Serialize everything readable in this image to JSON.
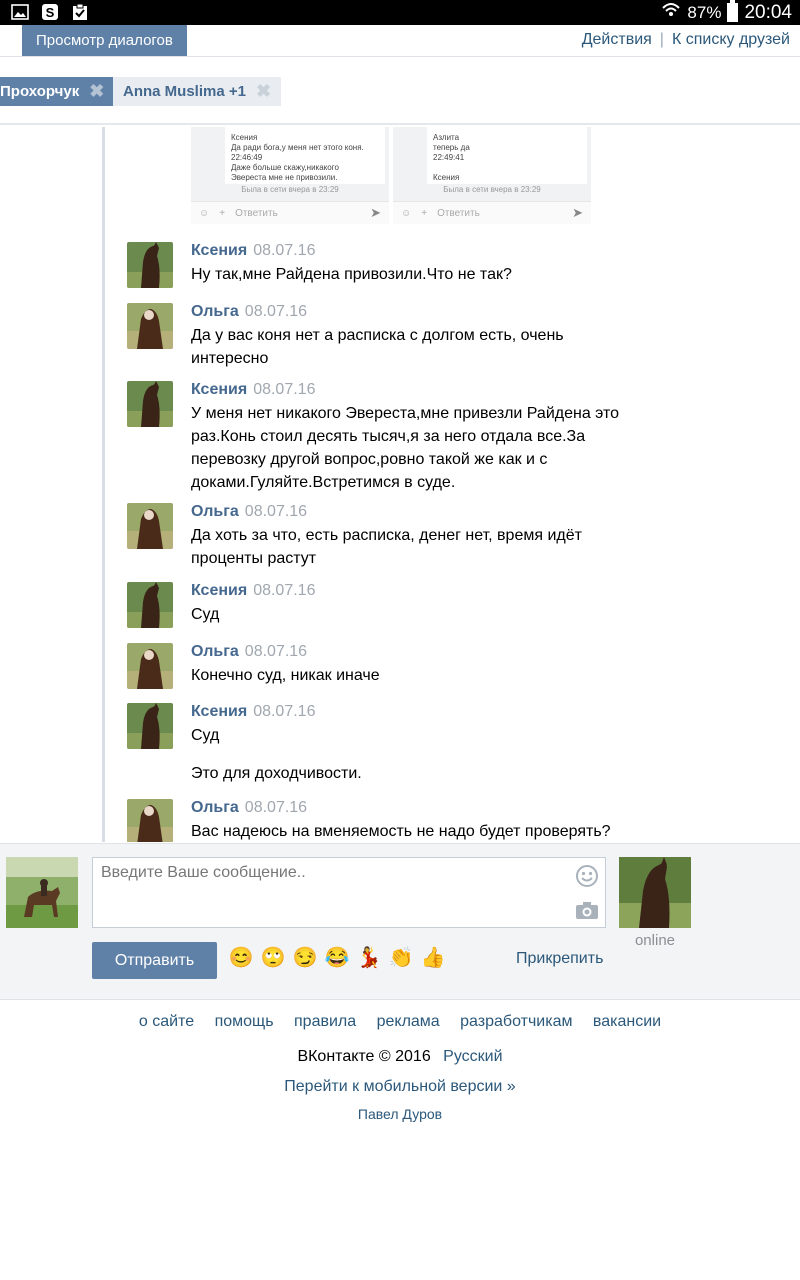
{
  "status_bar": {
    "battery": "87%",
    "time": "20:04"
  },
  "nav": {
    "active_tab": "Просмотр диалогов",
    "actions": "Действия",
    "separator": "|",
    "friends_link": "К списку друзей"
  },
  "dialog_tabs": [
    {
      "label": "Прохорчук"
    },
    {
      "label": "Anna Muslima +1"
    }
  ],
  "screenshot_thumbs": [
    {
      "author": "Ксения",
      "lines": [
        "Да ради бога,у меня нет этого коня.",
        "22:46:49",
        "Даже больше скажу,никакого",
        "Эвереста мне не привозили."
      ],
      "seen": "Была в сети вчера в 23:29",
      "reply": "Ответить"
    },
    {
      "author": "Азлита",
      "lines": [
        "теперь да",
        "22:49:41",
        "",
        "Ксения"
      ],
      "seen": "Была в сети вчера в 23:29",
      "reply": "Ответить"
    }
  ],
  "messages": [
    {
      "author": "Ксения",
      "date": "08.07.16",
      "text": "Ну так,мне Райдена привозили.Что не так?"
    },
    {
      "author": "Ольга",
      "date": "08.07.16",
      "text": "Да у вас коня нет а расписка с долгом есть, очень интересно"
    },
    {
      "author": "Ксения",
      "date": "08.07.16",
      "text": "У меня нет никакого Эвереста,мне привезли Райдена это раз.Конь стоил десять тысяч,я за него отдала все.За перевозку другой вопрос,ровно такой же как и с доками.Гуляйте.Встретимся в суде."
    },
    {
      "author": "Ольга",
      "date": "08.07.16",
      "text": "Да хоть за что, есть расписка, денег нет, время идёт проценты растут"
    },
    {
      "author": "Ксения",
      "date": "08.07.16",
      "text": "Суд"
    },
    {
      "author": "Ольга",
      "date": "08.07.16",
      "text": "Конечно суд, никак иначе"
    },
    {
      "author": "Ксения",
      "date": "08.07.16",
      "text": "Суд",
      "extra": "Это для доходчивости."
    },
    {
      "author": "Ольга",
      "date": "08.07.16",
      "text": "Вас надеюсь на вменяемость не надо будет проверять?"
    }
  ],
  "composer": {
    "placeholder": "Введите Ваше сообщение..",
    "send": "Отправить",
    "attach": "Прикрепить",
    "online": "online",
    "emojis": [
      "😊",
      "🙄",
      "😏",
      "😂",
      "💃",
      "👏",
      "👍"
    ]
  },
  "footer": {
    "links": [
      "о сайте",
      "помощь",
      "правила",
      "реклама",
      "разработчикам",
      "вакансии"
    ],
    "copyright": "ВКонтакте © 2016",
    "language": "Русский",
    "mobile": "Перейти к мобильной версии »",
    "author": "Павел Дуров"
  },
  "colors": {
    "accent": "#5f81a8",
    "link": "#2b587a",
    "author": "#45688e"
  }
}
